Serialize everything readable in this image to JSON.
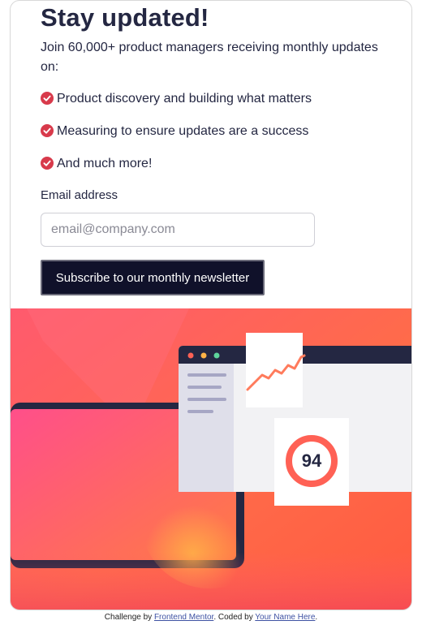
{
  "signup": {
    "title": "Stay updated!",
    "intro": "Join 60,000+ product managers receiving monthly updates on:",
    "features": [
      {
        "label": "Product discovery and building what matters",
        "icon": "check-circle-icon"
      },
      {
        "label": "Measuring to ensure updates are a success",
        "icon": "check-circle-icon"
      },
      {
        "label": "And much more!",
        "icon": "check-circle-icon"
      }
    ],
    "email_label": "Email address",
    "email_placeholder": "email@company.com",
    "email_value": "",
    "button_label": "Subscribe to our monthly newsletter"
  },
  "illustration": {
    "score": "94"
  },
  "footer": {
    "prefix": "Challenge by ",
    "challenge_link": "Frontend Mentor",
    "middle": ". Coded by ",
    "author_link": "Your Name Here",
    "suffix": "."
  },
  "colors": {
    "tomato": "#ff6155",
    "dark_navy": "#242742",
    "button_bg": "#10112a",
    "check": "#d83a4b",
    "gradient_start": "#ff527b",
    "gradient_end": "#ff6a3a"
  }
}
